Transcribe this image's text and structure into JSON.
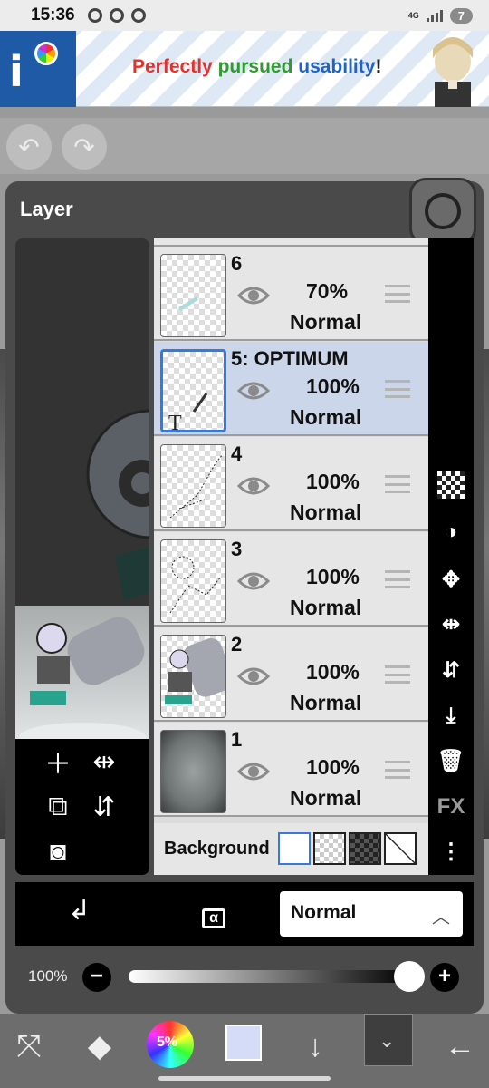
{
  "status_bar": {
    "time": "15:36",
    "network": "4G",
    "battery": "7"
  },
  "ad": {
    "words": [
      "Perfectly",
      "pursued",
      "usability",
      "!"
    ],
    "colors": {
      "w1": "#e2322d",
      "w2": "#2f9a2f",
      "w3": "#1f63c4"
    }
  },
  "panel": {
    "title": "Layer"
  },
  "layers": [
    {
      "name": "6",
      "opacity": "70%",
      "blend": "Normal",
      "selected": false
    },
    {
      "name": "5: OPTIMUM",
      "opacity": "100%",
      "blend": "Normal",
      "selected": true
    },
    {
      "name": "4",
      "opacity": "100%",
      "blend": "Normal",
      "selected": false
    },
    {
      "name": "3",
      "opacity": "100%",
      "blend": "Normal",
      "selected": false
    },
    {
      "name": "2",
      "opacity": "100%",
      "blend": "Normal",
      "selected": false
    },
    {
      "name": "1",
      "opacity": "100%",
      "blend": "Normal",
      "selected": false
    }
  ],
  "background": {
    "label": "Background"
  },
  "side_toolbar": {
    "fx_label": "FX"
  },
  "blend_bar": {
    "alpha_symbol": "α",
    "blend_mode": "Normal"
  },
  "opacity_slider": {
    "label": "100%",
    "value_percent": 100
  },
  "bottom_bar": {
    "color_percent": "5%",
    "current_color": "#d5dcf8"
  }
}
